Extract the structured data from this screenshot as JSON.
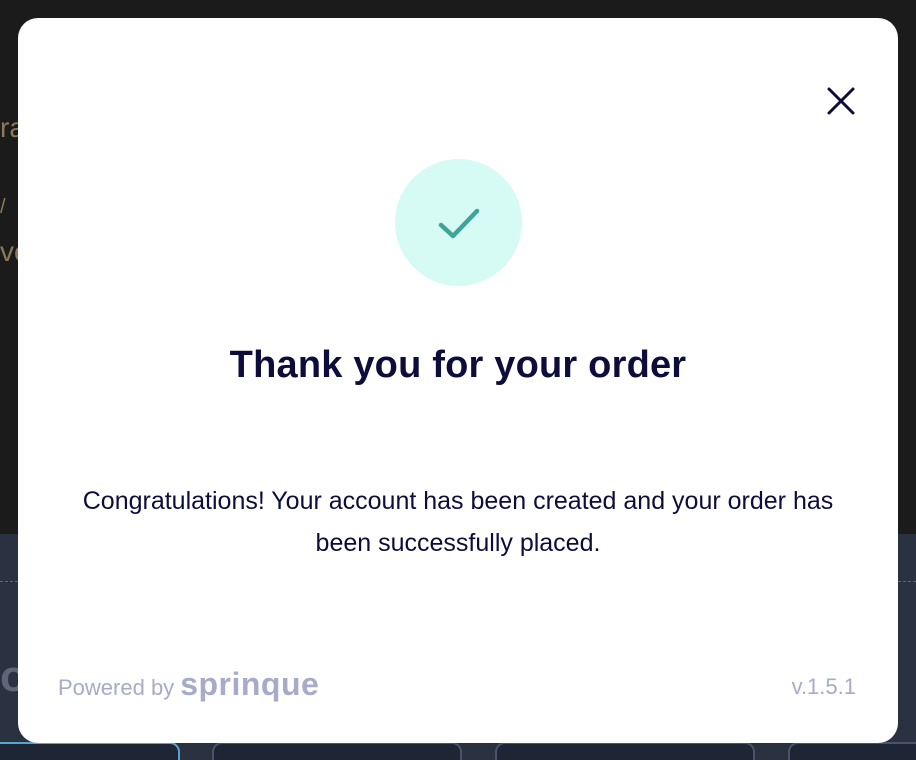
{
  "background": {
    "text_lines": [
      "ra",
      "/",
      "ve",
      "o"
    ]
  },
  "modal": {
    "close_icon": "close-icon",
    "success_icon": "checkmark-icon",
    "title": "Thank you for your order",
    "message": "Congratulations! Your account has been created and your order has been successfully placed.",
    "footer": {
      "powered_by": "Powered by",
      "brand": "sprinque",
      "version": "v.1.5.1"
    }
  },
  "colors": {
    "title_text": "#0c0d3a",
    "success_circle": "#d6faf4",
    "checkmark": "#3ea399",
    "footer_text": "#a6abc8",
    "overlay": "#1b1b1c"
  }
}
